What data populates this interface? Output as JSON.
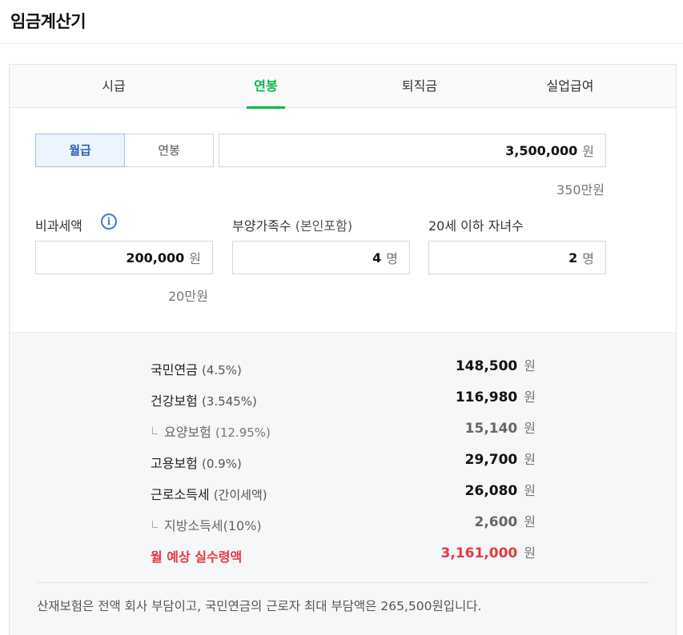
{
  "page": {
    "title": "임금계산기"
  },
  "tabs": [
    {
      "label": "시급"
    },
    {
      "label": "연봉"
    },
    {
      "label": "퇴직금"
    },
    {
      "label": "실업급여"
    }
  ],
  "salary_type": {
    "monthly": "월급",
    "annual": "연봉"
  },
  "salary_input": {
    "value": "3,500,000",
    "unit": "원",
    "hint": "350만원"
  },
  "nontax": {
    "label": "비과세액",
    "info": "i",
    "value": "200,000",
    "unit": "원",
    "hint": "20만원"
  },
  "dependents": {
    "label": "부양가족수",
    "label_paren": "(본인포함)",
    "value": "4",
    "unit": "명"
  },
  "children": {
    "label": "20세 이하 자녀수",
    "value": "2",
    "unit": "명"
  },
  "results": [
    {
      "label": "국민연금",
      "pct": "(4.5%)",
      "amount": "148,500",
      "unit": "원"
    },
    {
      "label": "건강보험",
      "pct": "(3.545%)",
      "amount": "116,980",
      "unit": "원"
    },
    {
      "label": "요양보험",
      "pct": "(12.95%)",
      "amount": "15,140",
      "unit": "원"
    },
    {
      "label": "고용보험",
      "pct": "(0.9%)",
      "amount": "29,700",
      "unit": "원"
    },
    {
      "label": "근로소득세",
      "pct": "(간이세액)",
      "amount": "26,080",
      "unit": "원"
    },
    {
      "label": "지방소득세(10%)",
      "pct": "",
      "amount": "2,600",
      "unit": "원"
    },
    {
      "label": "월 예상 실수령액",
      "pct": "",
      "amount": "3,161,000",
      "unit": "원"
    }
  ],
  "footnote": "산재보험은 전액 회사 부담이고, 국민연금의 근로자 최대 부담액은 265,500원입니다.",
  "colors": {
    "accent": "#00b843",
    "selected_blue": "#2b5fb7",
    "net_red": "#e8383d",
    "info_blue": "#3a7bd5"
  }
}
